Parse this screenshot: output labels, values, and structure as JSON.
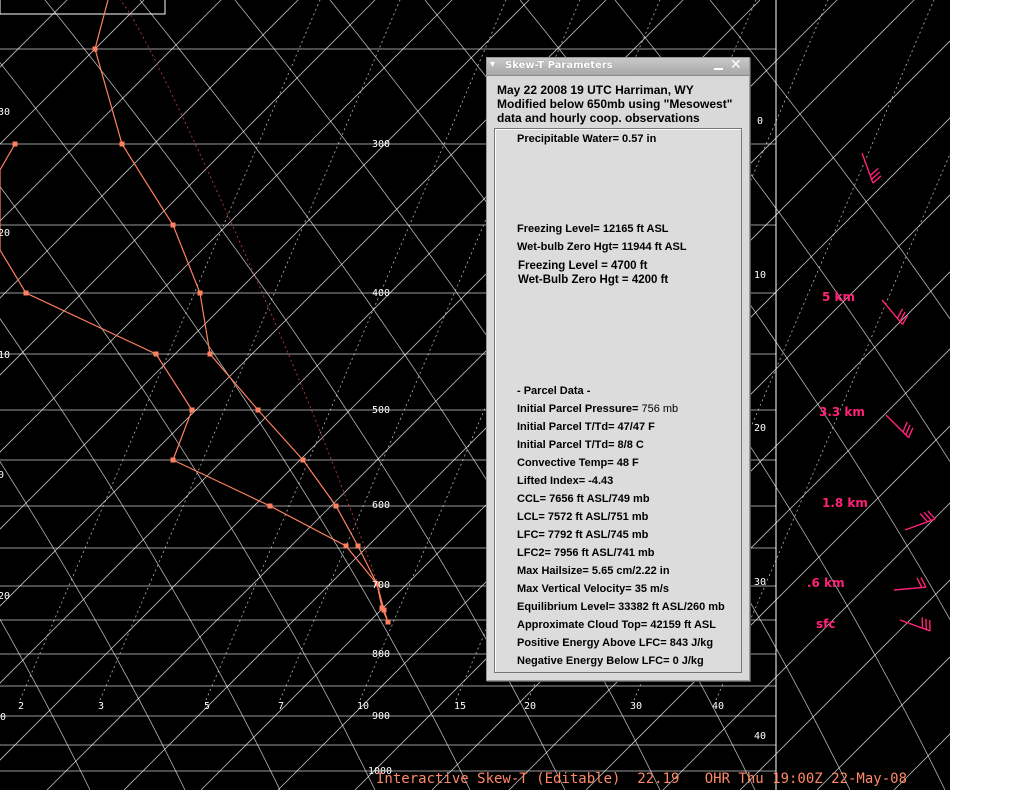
{
  "window": {
    "title": "Skew-T Parameters",
    "header_lines": [
      "May 22  2008  19 UTC Harriman, WY",
      "Modified below 650mb using \"Mesowest\"",
      "data and hourly coop. observations"
    ]
  },
  "params": {
    "precip_water": "Precipitable Water= 0.57 in",
    "freezing_level_asl": "Freezing Level= 12165 ft ASL",
    "wetbulb_zero_asl": "Wet-bulb Zero Hgt= 11944 ft ASL",
    "freezing_level": "Freezing Level = 4700 ft",
    "wetbulb_zero": "Wet-Bulb Zero Hgt = 4200 ft",
    "parcel_header": "- Parcel Data -",
    "initial_pressure_label": "Initial Parcel Pressure=",
    "initial_pressure_value": "756 mb",
    "initial_ttd_f": "Initial Parcel T/Td= 47/47 F",
    "initial_ttd_c": "Initial Parcel T/Td= 8/8 C",
    "convective_temp": "Convective Temp= 48 F",
    "lifted_index": "Lifted Index= -4.43",
    "ccl": "CCL= 7656 ft ASL/749 mb",
    "lcl": "LCL= 7572 ft ASL/751 mb",
    "lfc": "LFC= 7792 ft ASL/745 mb",
    "lfc2": "LFC2= 7956 ft ASL/741 mb",
    "max_hail": "Max Hailsize= 5.65 cm/2.22 in",
    "max_vv": "Max Vertical Velocity= 35 m/s",
    "el": "Equilibrium Level= 33382 ft ASL/260 mb",
    "cloud_top": "Approximate Cloud Top= 42159 ft ASL",
    "pos_energy": "Positive Energy Above LFC= 843 J/kg",
    "neg_energy": "Negative Energy Below LFC= 0 J/kg"
  },
  "pressure_labels": [
    "300",
    "400",
    "500",
    "600",
    "700",
    "800",
    "900",
    "1000"
  ],
  "temp_labels": [
    "2",
    "3",
    "5",
    "7",
    "10",
    "15",
    "20",
    "30",
    "40"
  ],
  "left_edge_labels": [
    "30",
    "20",
    "10",
    "0",
    "20",
    "30",
    "0"
  ],
  "right_edge_labels": [
    "0",
    "10",
    "20",
    "30",
    "40"
  ],
  "wind_labels": [
    "5 km",
    "3.3 km",
    "1.8 km",
    ".6 km",
    "sfc"
  ],
  "status_bar": "Interactive Skew-T (Editable)  22.19   OHR Thu 19:00Z 22-May-08",
  "colors": {
    "sounding": "#ff8060",
    "wind": "#ff2277",
    "grid": "#ffffff"
  }
}
